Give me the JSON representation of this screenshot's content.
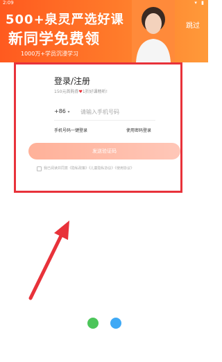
{
  "status_bar": {
    "time": "2:09",
    "icons": "▾ ▮"
  },
  "banner": {
    "headline": "500+泉灵严选好课",
    "subline": "新同学免费领",
    "tagline": "1000万+学员沉浸学习",
    "skip_label": "跳过"
  },
  "login": {
    "title": "登录/注册",
    "subtitle_before": "150元首购券",
    "subtitle_after": "1折好课畅听!",
    "country_code": "+86",
    "phone_placeholder": "请输入手机号码",
    "one_click_label": "手机号码一键登录",
    "password_label": "使用密码登录",
    "send_code_label": "发送验证码",
    "agreement_text": "我已阅读并同意《隐私政策》《儿童隐私协议》《使用协议》"
  },
  "icons": {
    "wechat": "wechat-icon",
    "qq": "qq-icon",
    "heart": "heart-icon",
    "arrow": "red-arrow-icon"
  },
  "colors": {
    "accent": "#ff5a1f",
    "highlight_border": "#e8323a",
    "button_bg": "#ffb199"
  }
}
